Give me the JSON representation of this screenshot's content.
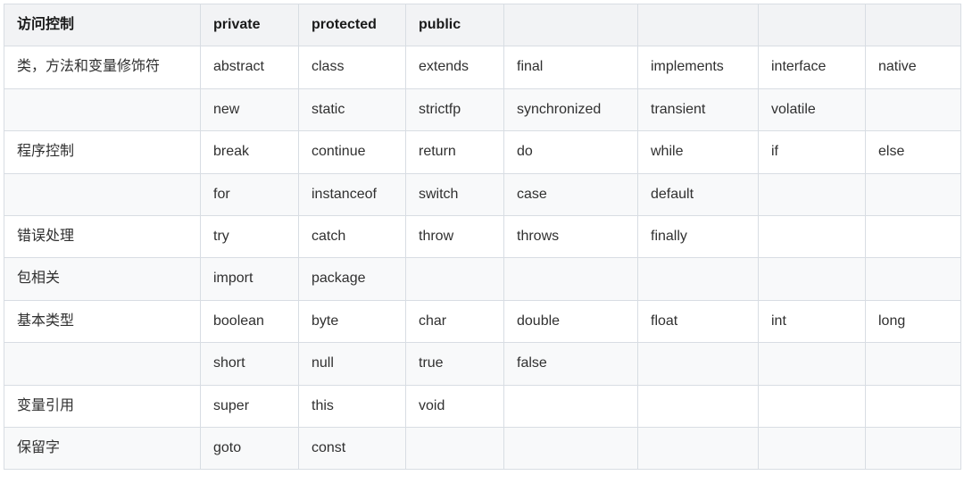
{
  "table": {
    "header": [
      "访问控制",
      "private",
      "protected",
      "public",
      "",
      "",
      "",
      ""
    ],
    "rows": [
      [
        "类，方法和变量修饰符",
        "abstract",
        "class",
        "extends",
        "final",
        "implements",
        "interface",
        "native"
      ],
      [
        "",
        "new",
        "static",
        "strictfp",
        "synchronized",
        "transient",
        "volatile",
        ""
      ],
      [
        "程序控制",
        "break",
        "continue",
        "return",
        "do",
        "while",
        "if",
        "else"
      ],
      [
        "",
        "for",
        "instanceof",
        "switch",
        "case",
        "default",
        "",
        ""
      ],
      [
        "错误处理",
        "try",
        "catch",
        "throw",
        "throws",
        "finally",
        "",
        ""
      ],
      [
        "包相关",
        "import",
        "package",
        "",
        "",
        "",
        "",
        ""
      ],
      [
        "基本类型",
        "boolean",
        "byte",
        "char",
        "double",
        "float",
        "int",
        "long"
      ],
      [
        "",
        "short",
        "null",
        "true",
        "false",
        "",
        "",
        ""
      ],
      [
        "变量引用",
        "super",
        "this",
        "void",
        "",
        "",
        "",
        ""
      ],
      [
        "保留字",
        "goto",
        "const",
        "",
        "",
        "",
        "",
        ""
      ]
    ]
  }
}
